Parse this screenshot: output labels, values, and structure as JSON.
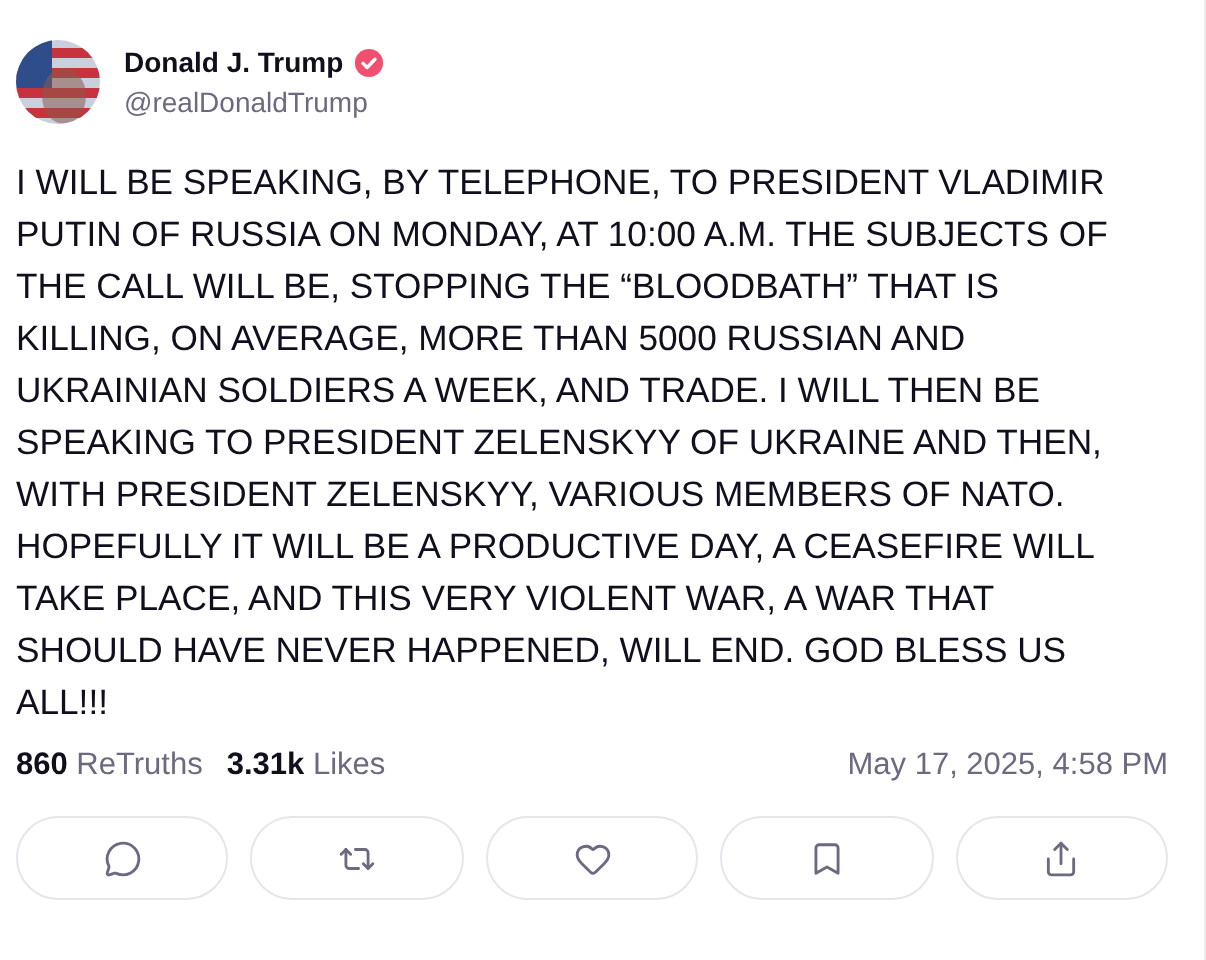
{
  "author": {
    "name": "Donald J. Trump",
    "verified": true,
    "handle": "@realDonaldTrump"
  },
  "body": "I WILL BE SPEAKING, BY TELEPHONE, TO PRESIDENT VLADIMIR PUTIN OF RUSSIA ON MONDAY, AT 10:00 A.M. THE SUBJECTS OF THE CALL WILL BE, STOPPING THE “BLOODBATH” THAT IS KILLING, ON AVERAGE, MORE THAN 5000 RUSSIAN AND UKRAINIAN SOLDIERS A WEEK, AND TRADE. I WILL THEN BE SPEAKING TO PRESIDENT ZELENSKYY OF UKRAINE AND THEN, WITH PRESIDENT ZELENSKYY, VARIOUS MEMBERS OF NATO. HOPEFULLY IT WILL BE A PRODUCTIVE DAY, A CEASEFIRE WILL TAKE PLACE, AND THIS VERY VIOLENT WAR, A WAR THAT SHOULD HAVE NEVER HAPPENED, WILL END. GOD BLESS US ALL!!!",
  "retruths": "**860** ReTruths",
  "likes": "**3.31k** Likes",
  "timestamp": "May 17, 2025, 4:58 PM",
  "actions": [
    {
      "kind": "reply"
    },
    {
      "kind": "retruth"
    },
    {
      "kind": "like"
    },
    {
      "kind": "bookmark"
    },
    {
      "kind": "share"
    }
  ]
}
